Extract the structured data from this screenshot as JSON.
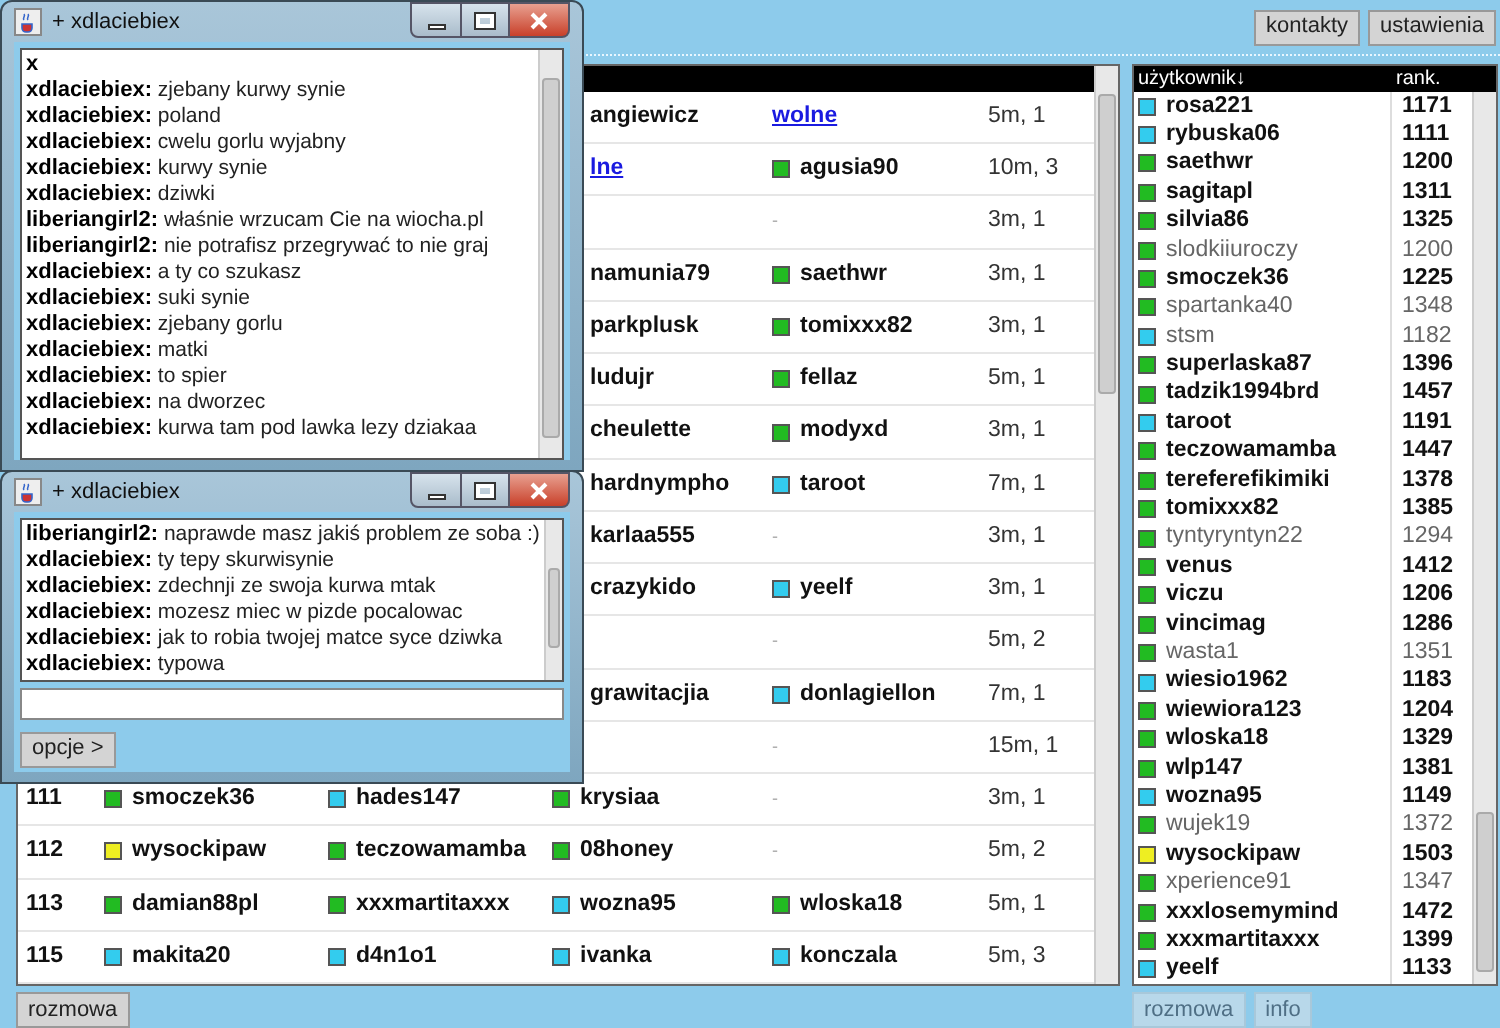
{
  "toolbar": {
    "buttons": [
      "kontakty",
      "ustawienia"
    ]
  },
  "games_table": {
    "rows": [
      {
        "player_3": {
          "kind": "text",
          "text": "angiewicz"
        },
        "player_4": {
          "kind": "link",
          "text": "wolne"
        },
        "time": "5m, 1"
      },
      {
        "player_3": {
          "kind": "link",
          "text": "lne"
        },
        "player_4": {
          "kind": "player",
          "name": "agusia90",
          "color": "#22bb22"
        },
        "time": "10m, 3"
      },
      {
        "player_4": {
          "kind": "dash",
          "text": "-"
        },
        "time": "3m, 1"
      },
      {
        "player_3": {
          "kind": "text",
          "text": "namunia79"
        },
        "player_4": {
          "kind": "player",
          "name": "saethwr",
          "color": "#22bb22"
        },
        "time": "3m, 1"
      },
      {
        "player_3": {
          "kind": "text",
          "text": "parkplusk"
        },
        "player_4": {
          "kind": "player",
          "name": "tomixxx82",
          "color": "#22bb22"
        },
        "time": "3m, 1"
      },
      {
        "player_3": {
          "kind": "text",
          "text": "ludujr"
        },
        "player_4": {
          "kind": "player",
          "name": "fellaz",
          "color": "#22bb22"
        },
        "time": "5m, 1"
      },
      {
        "player_3": {
          "kind": "text",
          "text": "cheulette"
        },
        "player_4": {
          "kind": "player",
          "name": "modyxd",
          "color": "#22bb22"
        },
        "time": "3m, 1"
      },
      {
        "player_3": {
          "kind": "text",
          "text": "hardnympho"
        },
        "player_4": {
          "kind": "player",
          "name": "taroot",
          "color": "#33ccee"
        },
        "time": "7m, 1"
      },
      {
        "player_3": {
          "kind": "text",
          "text": "karlaa555"
        },
        "player_4": {
          "kind": "dash",
          "text": "-"
        },
        "time": "3m, 1"
      },
      {
        "player_3": {
          "kind": "text",
          "text": "crazykido"
        },
        "player_4": {
          "kind": "player",
          "name": "yeelf",
          "color": "#33ccee"
        },
        "time": "3m, 1"
      },
      {
        "player_4": {
          "kind": "dash",
          "text": "-"
        },
        "time": "5m, 2"
      },
      {
        "player_3": {
          "kind": "text",
          "text": "grawitacjia"
        },
        "player_4": {
          "kind": "player",
          "name": "donlagiellon",
          "color": "#33ccee"
        },
        "time": "7m, 1"
      },
      {
        "player_4": {
          "kind": "dash",
          "text": "-"
        },
        "time": "15m, 1"
      },
      {
        "id": "111",
        "player_1": {
          "kind": "player",
          "name": "smoczek36",
          "color": "#22bb22"
        },
        "player_2": {
          "kind": "player",
          "name": "hades147",
          "color": "#33ccee"
        },
        "player_3": {
          "kind": "player",
          "name": "krysiaa",
          "color": "#22bb22"
        },
        "player_4": {
          "kind": "dash",
          "text": "-"
        },
        "time": "3m, 1"
      },
      {
        "id": "112",
        "player_1": {
          "kind": "player",
          "name": "wysockipaw",
          "color": "#eeee22"
        },
        "player_2": {
          "kind": "player",
          "name": "teczowamamba",
          "color": "#22bb22"
        },
        "player_3": {
          "kind": "player",
          "name": "08honey",
          "color": "#22bb22"
        },
        "player_4": {
          "kind": "dash",
          "text": "-"
        },
        "time": "5m, 2"
      },
      {
        "id": "113",
        "player_1": {
          "kind": "player",
          "name": "damian88pl",
          "color": "#22bb22"
        },
        "player_2": {
          "kind": "player",
          "name": "xxxmartitaxxx",
          "color": "#22bb22"
        },
        "player_3": {
          "kind": "player",
          "name": "wozna95",
          "color": "#33ccee"
        },
        "player_4": {
          "kind": "player",
          "name": "wloska18",
          "color": "#22bb22"
        },
        "time": "5m, 1"
      },
      {
        "id": "115",
        "player_1": {
          "kind": "player",
          "name": "makita20",
          "color": "#33ccee"
        },
        "player_2": {
          "kind": "player",
          "name": "d4n1o1",
          "color": "#33ccee"
        },
        "player_3": {
          "kind": "player",
          "name": "ivanka",
          "color": "#33ccee"
        },
        "player_4": {
          "kind": "player",
          "name": "konczala",
          "color": "#33ccee"
        },
        "time": "5m, 3"
      }
    ]
  },
  "users_list": {
    "columns": [
      "użytkownik↓",
      "rank."
    ],
    "rows": [
      {
        "name": "rosa221",
        "rank": "1171",
        "color": "#33ccee",
        "active": true
      },
      {
        "name": "rybuska06",
        "rank": "1111",
        "color": "#33ccee",
        "active": true
      },
      {
        "name": "saethwr",
        "rank": "1200",
        "color": "#22bb22",
        "active": true
      },
      {
        "name": "sagitapl",
        "rank": "1311",
        "color": "#22bb22",
        "active": true
      },
      {
        "name": "silvia86",
        "rank": "1325",
        "color": "#22bb22",
        "active": true
      },
      {
        "name": "slodkiiuroczy",
        "rank": "1200",
        "color": "#22bb22",
        "active": false
      },
      {
        "name": "smoczek36",
        "rank": "1225",
        "color": "#22bb22",
        "active": true
      },
      {
        "name": "spartanka40",
        "rank": "1348",
        "color": "#22bb22",
        "active": false
      },
      {
        "name": "stsm",
        "rank": "1182",
        "color": "#33ccee",
        "active": false
      },
      {
        "name": "superlaska87",
        "rank": "1396",
        "color": "#22bb22",
        "active": true
      },
      {
        "name": "tadzik1994brd",
        "rank": "1457",
        "color": "#22bb22",
        "active": true
      },
      {
        "name": "taroot",
        "rank": "1191",
        "color": "#33ccee",
        "active": true
      },
      {
        "name": "teczowamamba",
        "rank": "1447",
        "color": "#22bb22",
        "active": true
      },
      {
        "name": "tereferefikimiki",
        "rank": "1378",
        "color": "#22bb22",
        "active": true
      },
      {
        "name": "tomixxx82",
        "rank": "1385",
        "color": "#22bb22",
        "active": true
      },
      {
        "name": "tyntyryntyn22",
        "rank": "1294",
        "color": "#22bb22",
        "active": false
      },
      {
        "name": "venus",
        "rank": "1412",
        "color": "#22bb22",
        "active": true
      },
      {
        "name": "viczu",
        "rank": "1206",
        "color": "#22bb22",
        "active": true
      },
      {
        "name": "vincimag",
        "rank": "1286",
        "color": "#22bb22",
        "active": true
      },
      {
        "name": "wasta1",
        "rank": "1351",
        "color": "#22bb22",
        "active": false
      },
      {
        "name": "wiesio1962",
        "rank": "1183",
        "color": "#33ccee",
        "active": true
      },
      {
        "name": "wiewiora123",
        "rank": "1204",
        "color": "#22bb22",
        "active": true
      },
      {
        "name": "wloska18",
        "rank": "1329",
        "color": "#22bb22",
        "active": true
      },
      {
        "name": "wlp147",
        "rank": "1381",
        "color": "#22bb22",
        "active": true
      },
      {
        "name": "wozna95",
        "rank": "1149",
        "color": "#33ccee",
        "active": true
      },
      {
        "name": "wujek19",
        "rank": "1372",
        "color": "#22bb22",
        "active": false
      },
      {
        "name": "wysockipaw",
        "rank": "1503",
        "color": "#eeee22",
        "active": true
      },
      {
        "name": "xperience91",
        "rank": "1347",
        "color": "#22bb22",
        "active": false
      },
      {
        "name": "xxxlosemymind",
        "rank": "1472",
        "color": "#22bb22",
        "active": true
      },
      {
        "name": "xxxmartitaxxx",
        "rank": "1399",
        "color": "#22bb22",
        "active": true
      },
      {
        "name": "yeelf",
        "rank": "1133",
        "color": "#33ccee",
        "active": true
      }
    ]
  },
  "bottom_left": {
    "buttons": [
      {
        "label": "rozmowa",
        "disabled": false
      }
    ]
  },
  "bottom_right": {
    "buttons": [
      {
        "label": "rozmowa",
        "disabled": true
      },
      {
        "label": "info",
        "disabled": true
      }
    ]
  },
  "chat_windows": [
    {
      "title": "+ xdlaciebiex",
      "messages": [
        {
          "sender": "x"
        },
        {
          "sender": "xdlaciebiex:",
          "text": "zjebany kurwy synie"
        },
        {
          "sender": "xdlaciebiex:",
          "text": "poland"
        },
        {
          "sender": "xdlaciebiex:",
          "text": "cwelu gorlu wyjabny"
        },
        {
          "sender": "xdlaciebiex:",
          "text": "kurwy synie"
        },
        {
          "sender": "xdlaciebiex:",
          "text": "dziwki"
        },
        {
          "sender": "liberiangirl2:",
          "text": "właśnie wrzucam Cie na wiocha.pl"
        },
        {
          "sender": "liberiangirl2:",
          "text": "nie potrafisz przegrywać to nie graj"
        },
        {
          "sender": "xdlaciebiex:",
          "text": "a ty co szukasz"
        },
        {
          "sender": "xdlaciebiex:",
          "text": "suki synie"
        },
        {
          "sender": "xdlaciebiex:",
          "text": "zjebany gorlu"
        },
        {
          "sender": "xdlaciebiex:",
          "text": "matki"
        },
        {
          "sender": "xdlaciebiex:",
          "text": "to spier"
        },
        {
          "sender": "xdlaciebiex:",
          "text": "na dworzec"
        },
        {
          "sender": "xdlaciebiex:",
          "text": "kurwa tam pod lawka lezy dziakaa"
        }
      ]
    },
    {
      "title": "+ xdlaciebiex",
      "messages": [
        {
          "sender": "liberiangirl2:",
          "text": "naprawde masz jakiś problem ze soba :)"
        },
        {
          "sender": "xdlaciebiex:",
          "text": "ty tepy skurwisynie"
        },
        {
          "sender": "xdlaciebiex:",
          "text": "zdechnji ze swoja kurwa mtak"
        },
        {
          "sender": "xdlaciebiex:",
          "text": "mozesz miec w pizde pocalowac"
        },
        {
          "sender": "xdlaciebiex:",
          "text": "jak to robia twojej matce syce dziwka"
        },
        {
          "sender": "xdlaciebiex:",
          "text": "typowa"
        }
      ],
      "input": true,
      "button": "opcje >"
    }
  ]
}
